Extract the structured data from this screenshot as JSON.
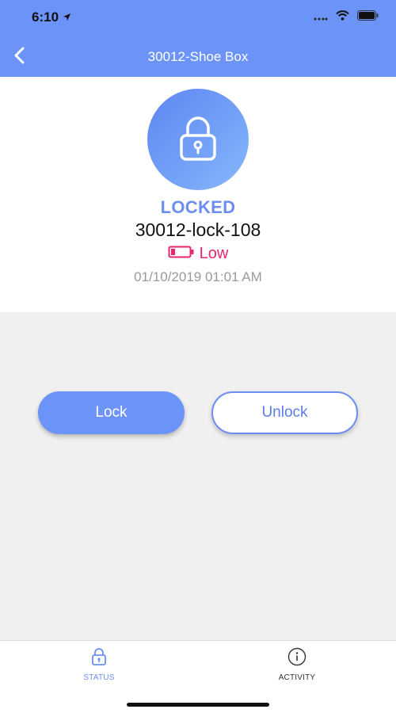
{
  "status_bar": {
    "time": "6:10"
  },
  "nav": {
    "title": "30012-Shoe Box"
  },
  "lock": {
    "state": "LOCKED",
    "name": "30012-lock-108",
    "battery_label": "Low",
    "timestamp": "01/10/2019 01:01 AM"
  },
  "actions": {
    "lock_label": "Lock",
    "unlock_label": "Unlock"
  },
  "tabs": [
    {
      "label": "STATUS",
      "icon": "lock-icon",
      "active": true
    },
    {
      "label": "ACTIVITY",
      "icon": "info-icon",
      "active": false
    }
  ],
  "colors": {
    "accent": "#6c93f7",
    "low_battery": "#e8246e",
    "background": "#f0f0f0"
  }
}
